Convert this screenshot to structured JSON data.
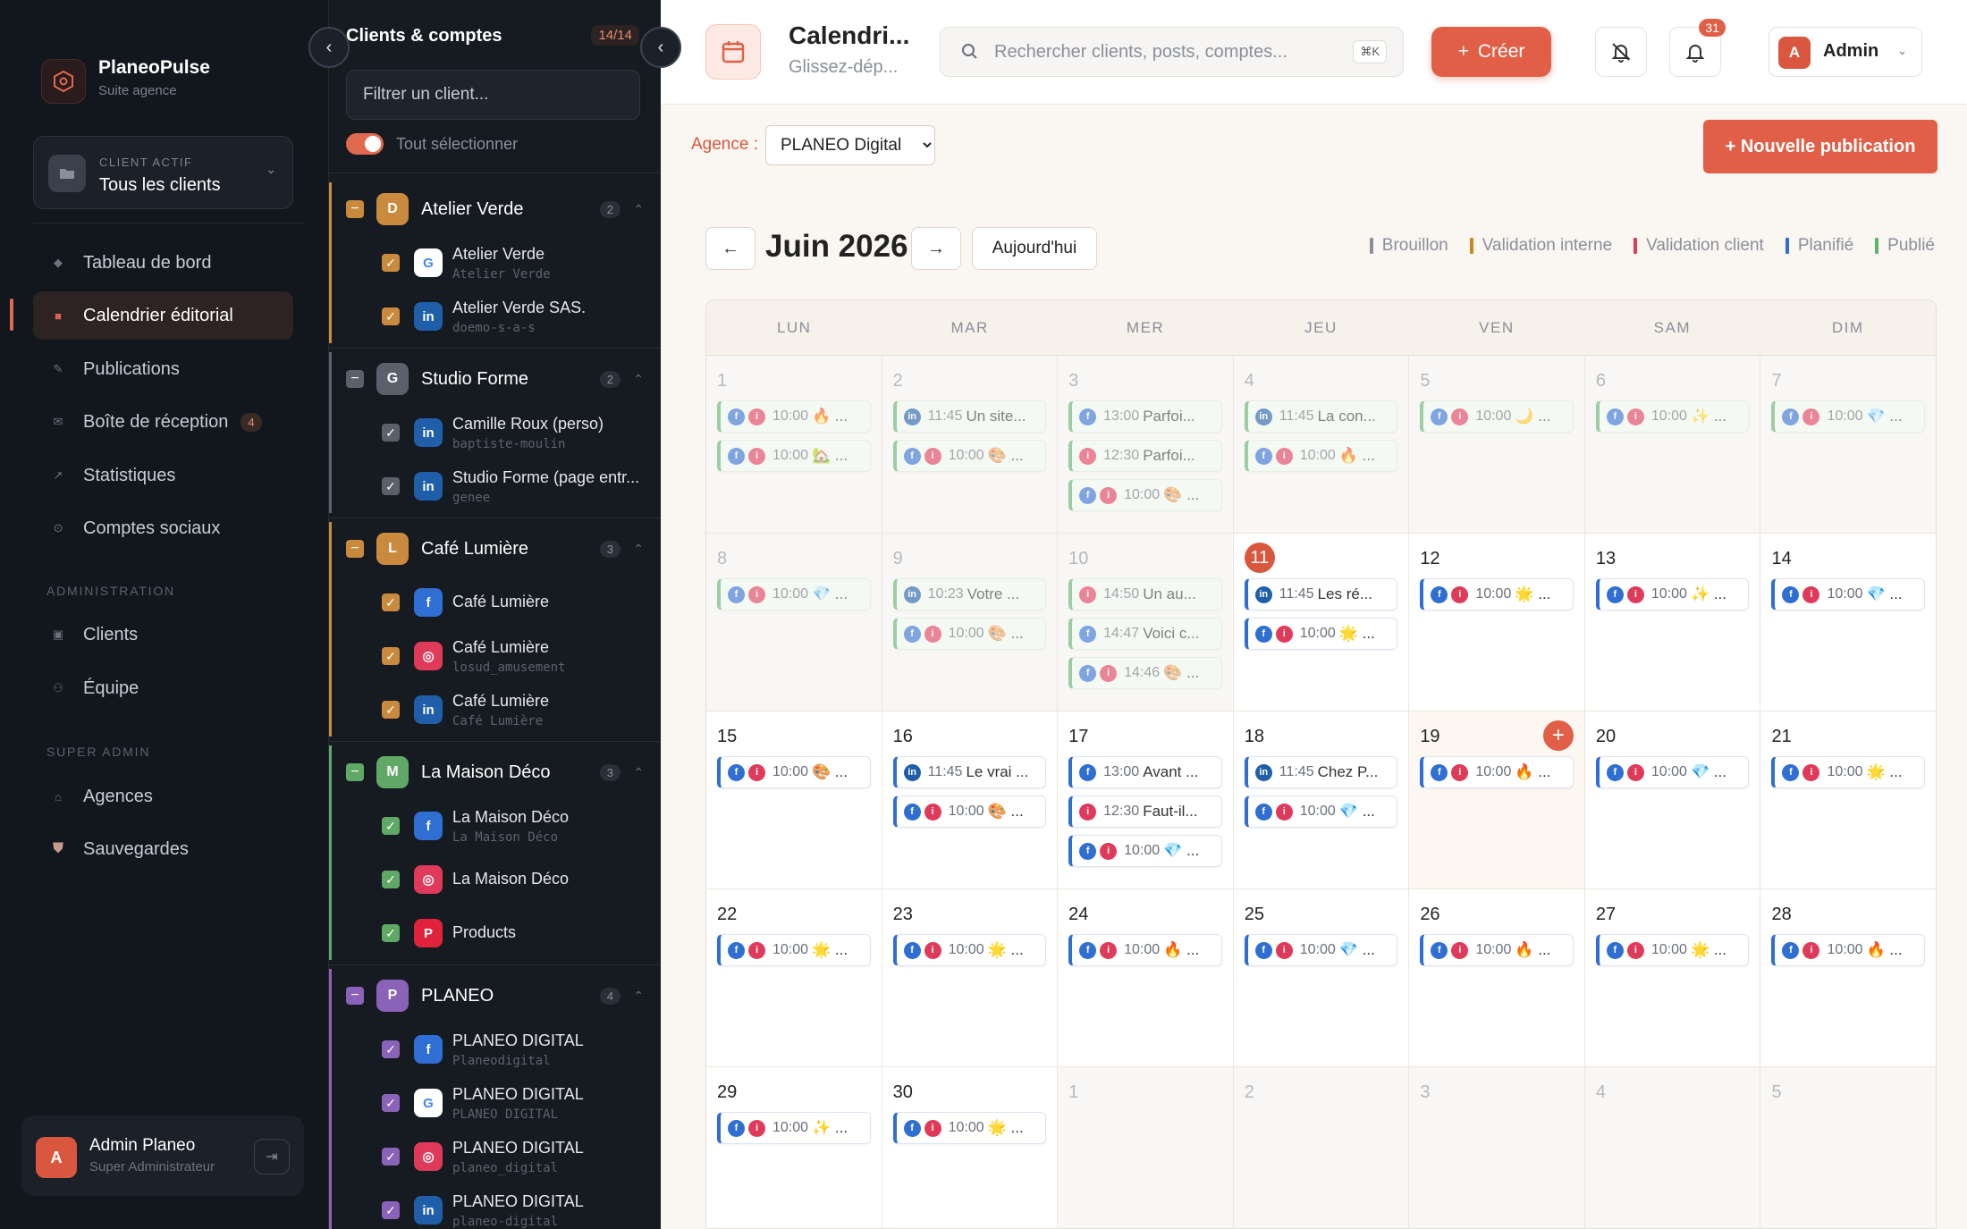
{
  "app": {
    "name": "PlaneoPulse",
    "subtitle": "Suite agence"
  },
  "active_client": {
    "label": "CLIENT ACTIF",
    "value": "Tous les clients"
  },
  "nav": {
    "items": [
      {
        "label": "Tableau de bord",
        "icon": "diamond-icon"
      },
      {
        "label": "Calendrier éditorial",
        "icon": "calendar-square-icon"
      },
      {
        "label": "Publications",
        "icon": "pencil-icon"
      },
      {
        "label": "Boîte de réception",
        "icon": "mail-icon",
        "badge": "4"
      },
      {
        "label": "Statistiques",
        "icon": "trend-icon"
      },
      {
        "label": "Comptes sociaux",
        "icon": "circle-icon"
      }
    ],
    "admin_section": "ADMINISTRATION",
    "admin_items": [
      {
        "label": "Clients"
      },
      {
        "label": "Équipe"
      }
    ],
    "super_section": "SUPER ADMIN",
    "super_items": [
      {
        "label": "Agences"
      },
      {
        "label": "Sauvegardes"
      }
    ]
  },
  "user": {
    "initial": "A",
    "name": "Admin Planeo",
    "role": "Super Administrateur"
  },
  "clients_panel": {
    "title": "Clients & comptes",
    "count": "14/14",
    "filter_placeholder": "Filtrer un client...",
    "select_all": "Tout sélectionner",
    "groups": [
      {
        "initial": "D",
        "name": "Atelier Verde",
        "count": "2",
        "color": "#c98a3e",
        "accounts": [
          {
            "name": "Atelier Verde",
            "sub": "Atelier Verde",
            "network": "google"
          },
          {
            "name": "Atelier Verde SAS.",
            "sub": "doemo-s-a-s",
            "network": "linkedin"
          }
        ]
      },
      {
        "initial": "G",
        "name": "Studio Forme",
        "count": "2",
        "color": "#5b616b",
        "accounts": [
          {
            "name": "Camille Roux (perso)",
            "sub": "baptiste-moulin",
            "network": "linkedin"
          },
          {
            "name": "Studio Forme (page entr...",
            "sub": "genee",
            "network": "linkedin"
          }
        ]
      },
      {
        "initial": "L",
        "name": "Café Lumière",
        "count": "3",
        "color": "#c98a3e",
        "accounts": [
          {
            "name": "Café Lumière",
            "sub": "",
            "network": "facebook"
          },
          {
            "name": "Café Lumière",
            "sub": "losud_amusement",
            "network": "instagram"
          },
          {
            "name": "Café Lumière",
            "sub": "Café Lumière",
            "network": "linkedin"
          }
        ]
      },
      {
        "initial": "M",
        "name": "La Maison Déco",
        "count": "3",
        "color": "#5fa866",
        "accounts": [
          {
            "name": "La Maison Déco",
            "sub": "La Maison Déco",
            "network": "facebook"
          },
          {
            "name": "La Maison Déco",
            "sub": "",
            "network": "instagram"
          },
          {
            "name": "Products",
            "sub": "",
            "network": "pinterest"
          }
        ]
      },
      {
        "initial": "P",
        "name": "PLANEO",
        "count": "4",
        "color": "#8a62b8",
        "accounts": [
          {
            "name": "PLANEO DIGITAL",
            "sub": "Planeodigital",
            "network": "facebook"
          },
          {
            "name": "PLANEO DIGITAL",
            "sub": "PLANEO DIGITAL",
            "network": "google"
          },
          {
            "name": "PLANEO DIGITAL",
            "sub": "planeo_digital",
            "network": "instagram"
          },
          {
            "name": "PLANEO DIGITAL",
            "sub": "planeo-digital",
            "network": "linkedin"
          }
        ]
      }
    ]
  },
  "header": {
    "title": "Calendri...",
    "subtitle": "Glissez-dép...",
    "search_placeholder": "Rechercher clients, posts, comptes...",
    "search_shortcut": "⌘K",
    "create_label": "Créer",
    "notifications_count": "31",
    "admin_initial": "A",
    "admin_name": "Admin"
  },
  "toolbar": {
    "agency_label": "Agence :",
    "agency_selected": "PLANEO Digital",
    "new_publication": "+ Nouvelle publication"
  },
  "calendar": {
    "month_label": "Juin 2026",
    "today_label": "Aujourd'hui",
    "legend": [
      {
        "label": "Brouillon",
        "color": "#8a8f99"
      },
      {
        "label": "Validation interne",
        "color": "#c98a1e"
      },
      {
        "label": "Validation client",
        "color": "#e03a5a"
      },
      {
        "label": "Planifié",
        "color": "#2f6ed3"
      },
      {
        "label": "Publié",
        "color": "#5fb36b"
      }
    ],
    "weekdays": [
      "LUN",
      "MAR",
      "MER",
      "JEU",
      "VEN",
      "SAM",
      "DIM"
    ],
    "weeks": [
      [
        {
          "day": "1",
          "out": true,
          "events": [
            {
              "p": "fi",
              "t": "10:00",
              "tx": "🔥 ...",
              "s": "green"
            },
            {
              "p": "fi",
              "t": "10:00",
              "tx": "🏡 ...",
              "s": "green"
            }
          ]
        },
        {
          "day": "2",
          "out": true,
          "events": [
            {
              "p": "l",
              "t": "11:45",
              "tx": "Un site...",
              "s": "green"
            },
            {
              "p": "fi",
              "t": "10:00",
              "tx": "🎨 ...",
              "s": "green"
            }
          ]
        },
        {
          "day": "3",
          "out": true,
          "events": [
            {
              "p": "f",
              "t": "13:00",
              "tx": "Parfoi...",
              "s": "green"
            },
            {
              "p": "i",
              "t": "12:30",
              "tx": "Parfoi...",
              "s": "green"
            },
            {
              "p": "fi",
              "t": "10:00",
              "tx": "🎨 ...",
              "s": "green"
            }
          ]
        },
        {
          "day": "4",
          "out": true,
          "events": [
            {
              "p": "l",
              "t": "11:45",
              "tx": "La con...",
              "s": "green"
            },
            {
              "p": "fi",
              "t": "10:00",
              "tx": "🔥 ...",
              "s": "green"
            }
          ]
        },
        {
          "day": "5",
          "out": true,
          "events": [
            {
              "p": "fi",
              "t": "10:00",
              "tx": "🌙 ...",
              "s": "green"
            }
          ]
        },
        {
          "day": "6",
          "out": true,
          "events": [
            {
              "p": "fi",
              "t": "10:00",
              "tx": "✨ ...",
              "s": "green"
            }
          ]
        },
        {
          "day": "7",
          "out": true,
          "events": [
            {
              "p": "fi",
              "t": "10:00",
              "tx": "💎 ...",
              "s": "green"
            }
          ]
        }
      ],
      [
        {
          "day": "8",
          "out": true,
          "events": [
            {
              "p": "fi",
              "t": "10:00",
              "tx": "💎 ...",
              "s": "green"
            }
          ]
        },
        {
          "day": "9",
          "out": true,
          "events": [
            {
              "p": "l",
              "t": "10:23",
              "tx": "Votre ...",
              "s": "green"
            },
            {
              "p": "fi",
              "t": "10:00",
              "tx": "🎨 ...",
              "s": "green"
            }
          ]
        },
        {
          "day": "10",
          "out": true,
          "events": [
            {
              "p": "i",
              "t": "14:50",
              "tx": "Un au...",
              "s": "green"
            },
            {
              "p": "f",
              "t": "14:47",
              "tx": "Voici c...",
              "s": "green"
            },
            {
              "p": "fi",
              "t": "14:46",
              "tx": "🎨 ...",
              "s": "green"
            }
          ]
        },
        {
          "day": "11",
          "today": true,
          "events": [
            {
              "p": "l",
              "t": "11:45",
              "tx": "Les ré...",
              "s": "blue"
            },
            {
              "p": "fi",
              "t": "10:00",
              "tx": "🌟 ...",
              "s": "blue"
            }
          ]
        },
        {
          "day": "12",
          "events": [
            {
              "p": "fi",
              "t": "10:00",
              "tx": "🌟 ...",
              "s": "blue"
            }
          ]
        },
        {
          "day": "13",
          "events": [
            {
              "p": "fi",
              "t": "10:00",
              "tx": "✨ ...",
              "s": "blue"
            }
          ]
        },
        {
          "day": "14",
          "events": [
            {
              "p": "fi",
              "t": "10:00",
              "tx": "💎 ...",
              "s": "blue"
            }
          ]
        }
      ],
      [
        {
          "day": "15",
          "events": [
            {
              "p": "fi",
              "t": "10:00",
              "tx": "🎨 ...",
              "s": "blue"
            }
          ]
        },
        {
          "day": "16",
          "events": [
            {
              "p": "l",
              "t": "11:45",
              "tx": "Le vrai ...",
              "s": "blue"
            },
            {
              "p": "fi",
              "t": "10:00",
              "tx": "🎨 ...",
              "s": "blue"
            }
          ]
        },
        {
          "day": "17",
          "events": [
            {
              "p": "f",
              "t": "13:00",
              "tx": "Avant ...",
              "s": "blue"
            },
            {
              "p": "i",
              "t": "12:30",
              "tx": "Faut-il...",
              "s": "blue"
            },
            {
              "p": "fi",
              "t": "10:00",
              "tx": "💎 ...",
              "s": "blue"
            }
          ]
        },
        {
          "day": "18",
          "events": [
            {
              "p": "l",
              "t": "11:45",
              "tx": "Chez P...",
              "s": "blue"
            },
            {
              "p": "fi",
              "t": "10:00",
              "tx": "💎 ...",
              "s": "blue"
            }
          ]
        },
        {
          "day": "19",
          "hl": true,
          "add": true,
          "events": [
            {
              "p": "fi",
              "t": "10:00",
              "tx": "🔥 ...",
              "s": "blue"
            }
          ]
        },
        {
          "day": "20",
          "events": [
            {
              "p": "fi",
              "t": "10:00",
              "tx": "💎 ...",
              "s": "blue"
            }
          ]
        },
        {
          "day": "21",
          "events": [
            {
              "p": "fi",
              "t": "10:00",
              "tx": "🌟 ...",
              "s": "blue"
            }
          ]
        }
      ],
      [
        {
          "day": "22",
          "events": [
            {
              "p": "fi",
              "t": "10:00",
              "tx": "🌟 ...",
              "s": "blue"
            }
          ]
        },
        {
          "day": "23",
          "events": [
            {
              "p": "fi",
              "t": "10:00",
              "tx": "🌟 ...",
              "s": "blue"
            }
          ]
        },
        {
          "day": "24",
          "events": [
            {
              "p": "fi",
              "t": "10:00",
              "tx": "🔥 ...",
              "s": "blue"
            }
          ]
        },
        {
          "day": "25",
          "events": [
            {
              "p": "fi",
              "t": "10:00",
              "tx": "💎 ...",
              "s": "blue"
            }
          ]
        },
        {
          "day": "26",
          "events": [
            {
              "p": "fi",
              "t": "10:00",
              "tx": "🔥 ...",
              "s": "blue"
            }
          ]
        },
        {
          "day": "27",
          "events": [
            {
              "p": "fi",
              "t": "10:00",
              "tx": "🌟 ...",
              "s": "blue"
            }
          ]
        },
        {
          "day": "28",
          "events": [
            {
              "p": "fi",
              "t": "10:00",
              "tx": "🔥 ...",
              "s": "blue"
            }
          ]
        }
      ],
      [
        {
          "day": "29",
          "events": [
            {
              "p": "fi",
              "t": "10:00",
              "tx": "✨ ...",
              "s": "blue"
            }
          ]
        },
        {
          "day": "30",
          "events": [
            {
              "p": "fi",
              "t": "10:00",
              "tx": "🌟 ...",
              "s": "blue"
            }
          ]
        },
        {
          "day": "1",
          "out": true,
          "events": []
        },
        {
          "day": "2",
          "out": true,
          "events": []
        },
        {
          "day": "3",
          "out": true,
          "events": []
        },
        {
          "day": "4",
          "out": true,
          "events": []
        },
        {
          "day": "5",
          "out": true,
          "events": []
        }
      ]
    ]
  }
}
